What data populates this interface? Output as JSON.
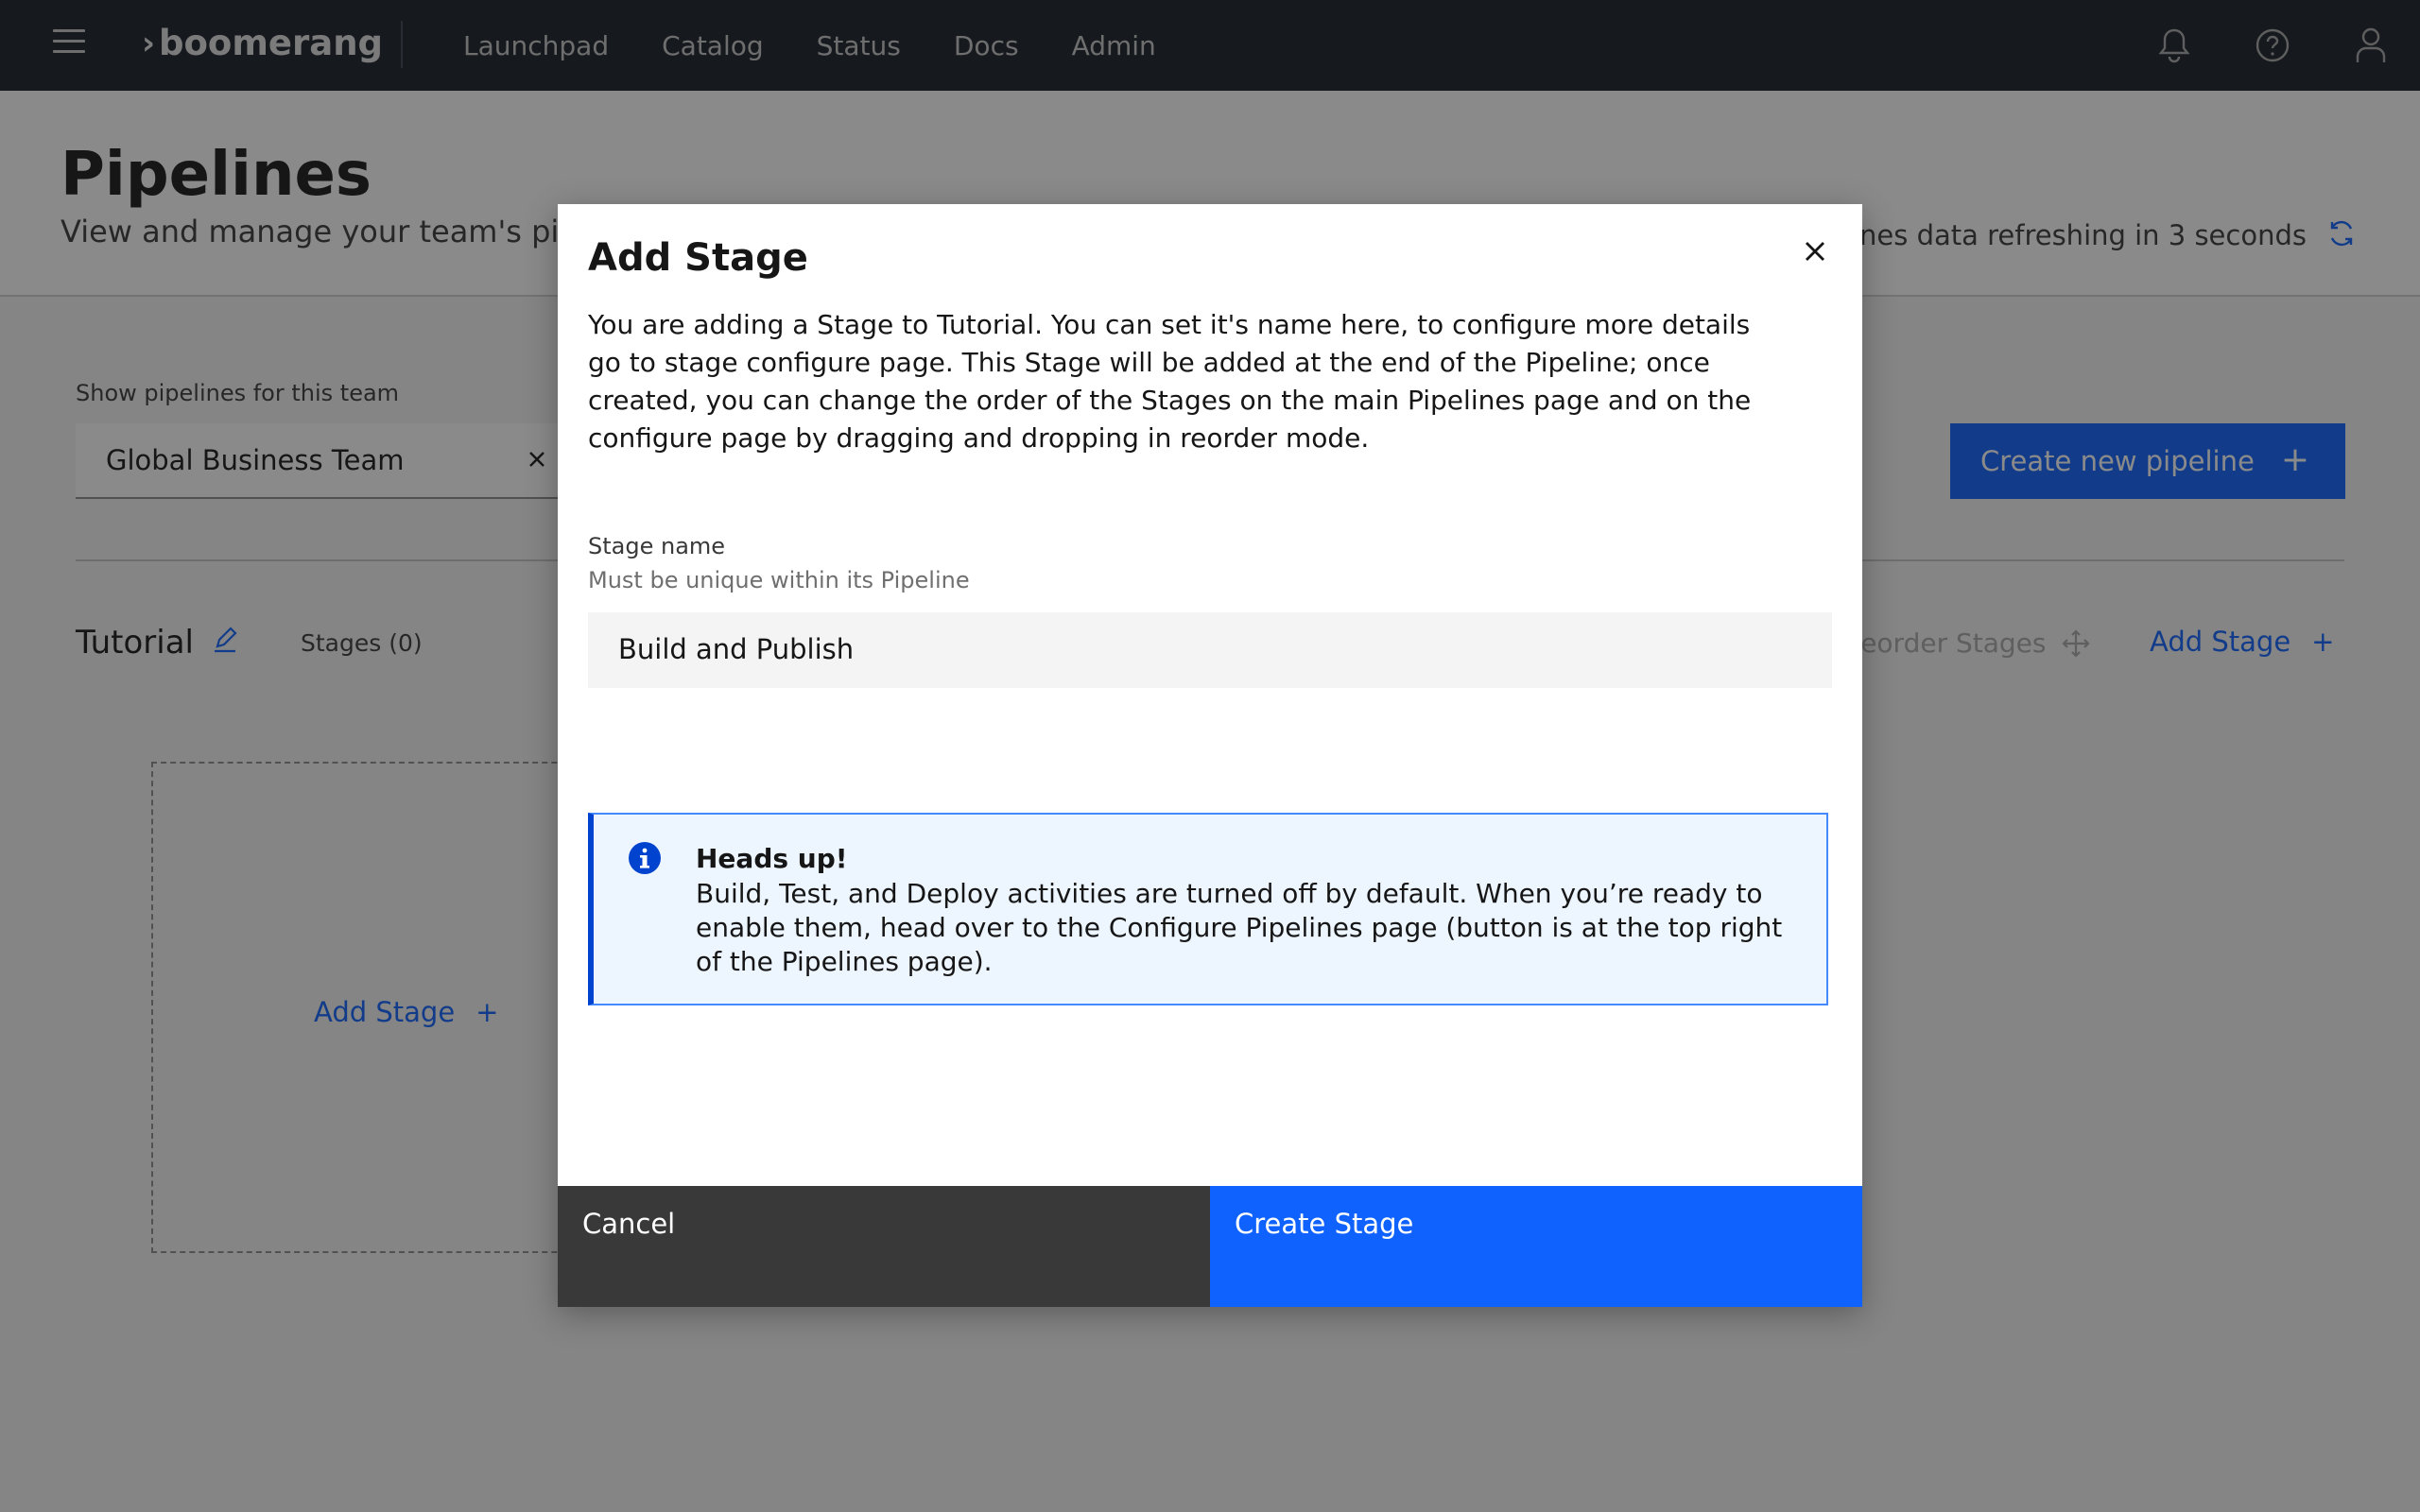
{
  "header": {
    "brand": "boomerang",
    "nav": [
      "Launchpad",
      "Catalog",
      "Status",
      "Docs",
      "Admin"
    ]
  },
  "page": {
    "title": "Pipelines",
    "subtitle": "View and manage your team's pipelines",
    "refresh_text": "Pipelines data refreshing in 3 seconds"
  },
  "team": {
    "label": "Show pipelines for this team",
    "selected": "Global Business Team",
    "create_button": "Create new pipeline"
  },
  "pipeline": {
    "name": "Tutorial",
    "stages_count": "Stages (0)",
    "reorder_label": "Reorder Stages",
    "add_stage_label": "Add Stage"
  },
  "modal": {
    "title": "Add Stage",
    "description": "You are adding a Stage to Tutorial. You can set it's name here, to configure more details go to stage configure page. This Stage will be added at the end of the Pipeline; once created, you can change the order of the Stages on the main Pipelines page and on the configure page by dragging and dropping in reorder mode.",
    "field_label": "Stage name",
    "field_helper": "Must be unique within its Pipeline",
    "field_value": "Build and Publish",
    "notification": {
      "title": "Heads up!",
      "body": "Build, Test, and Deploy activities are turned off by default. When you’re ready to enable them, head over to the Configure Pipelines page (button is at the top right of the Pipelines page)."
    },
    "cancel_label": "Cancel",
    "submit_label": "Create Stage"
  },
  "colors": {
    "topbar": "#161e28",
    "primary": "#0f62fe",
    "info": "#0043ce",
    "secondary": "#393939"
  }
}
